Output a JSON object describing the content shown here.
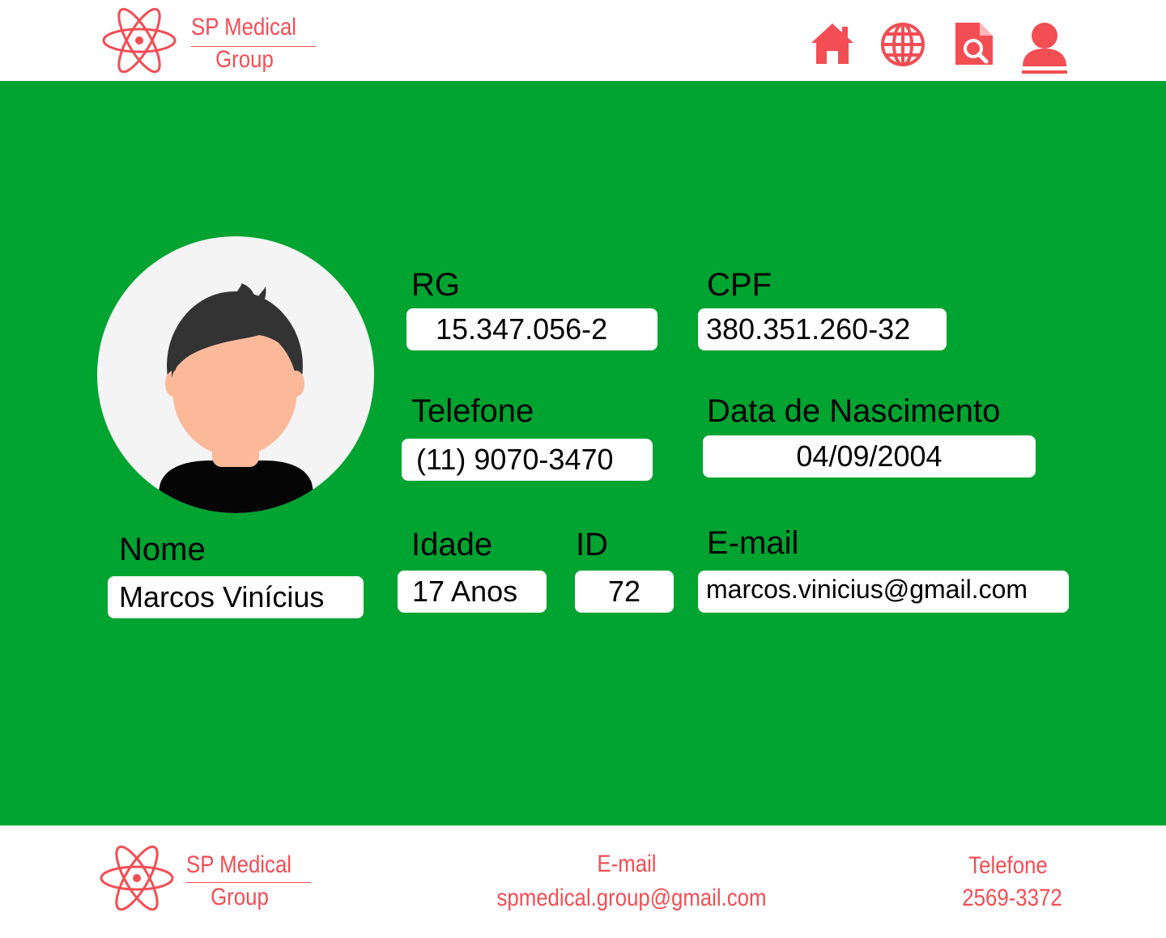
{
  "brand": {
    "name_line1": "SP Medical",
    "name_line2": "Group",
    "color": "#f24e54"
  },
  "nav": {
    "icons": [
      "home-icon",
      "globe-icon",
      "document-search-icon",
      "user-icon"
    ]
  },
  "profile": {
    "avatar": "person-avatar",
    "fields": {
      "nome": {
        "label": "Nome",
        "value": "Marcos Vinícius"
      },
      "rg": {
        "label": "RG",
        "value": "15.347.056-2"
      },
      "cpf": {
        "label": "CPF",
        "value": "380.351.260-32"
      },
      "telefone": {
        "label": "Telefone",
        "value": "(11) 9070-3470"
      },
      "nascimento": {
        "label": "Data de Nascimento",
        "value": "04/09/2004"
      },
      "idade": {
        "label": "Idade",
        "value": "17 Anos"
      },
      "id": {
        "label": "ID",
        "value": "72"
      },
      "email": {
        "label": "E-mail",
        "value": "marcos.vinicius@gmail.com"
      }
    }
  },
  "footer": {
    "email_label": "E-mail",
    "email_value": "spmedical.group@gmail.com",
    "phone_label": "Telefone",
    "phone_value": "2569-3372"
  },
  "colors": {
    "main_background": "#01a331",
    "accent": "#f24e54",
    "field_background": "#ffffff"
  }
}
